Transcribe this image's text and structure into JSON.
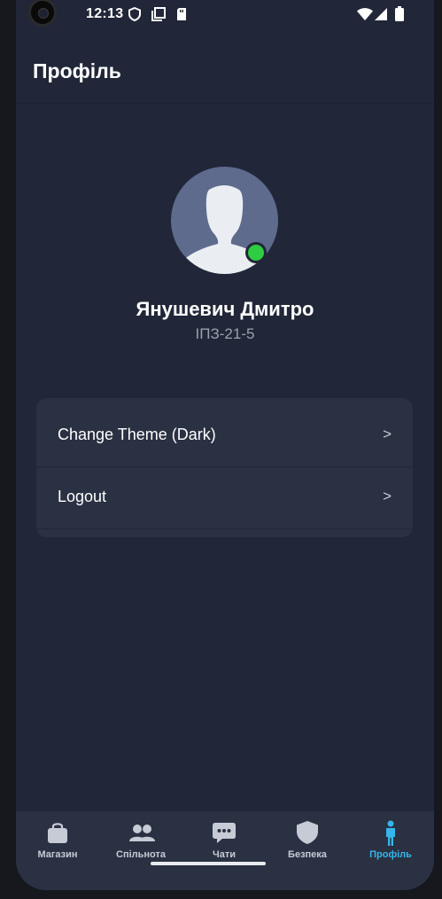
{
  "status_bar": {
    "time": "12:13"
  },
  "header": {
    "title": "Профіль"
  },
  "profile": {
    "name": "Янушевич Дмитро",
    "group": "ІПЗ-21-5",
    "online": true
  },
  "menu": [
    {
      "label": "Change Theme (Dark)",
      "chevron": ">"
    },
    {
      "label": "Logout",
      "chevron": ">"
    }
  ],
  "tabs": [
    {
      "label": "Магазин",
      "icon": "shopping-bag-icon"
    },
    {
      "label": "Спільнота",
      "icon": "people-icon"
    },
    {
      "label": "Чати",
      "icon": "chat-bubble-icon"
    },
    {
      "label": "Безпека",
      "icon": "shield-icon"
    },
    {
      "label": "Профіль",
      "icon": "person-icon",
      "active": true
    }
  ],
  "colors": {
    "background": "#212738",
    "card": "#2a3142",
    "accent": "#35b6ea",
    "online": "#2ecc40"
  }
}
